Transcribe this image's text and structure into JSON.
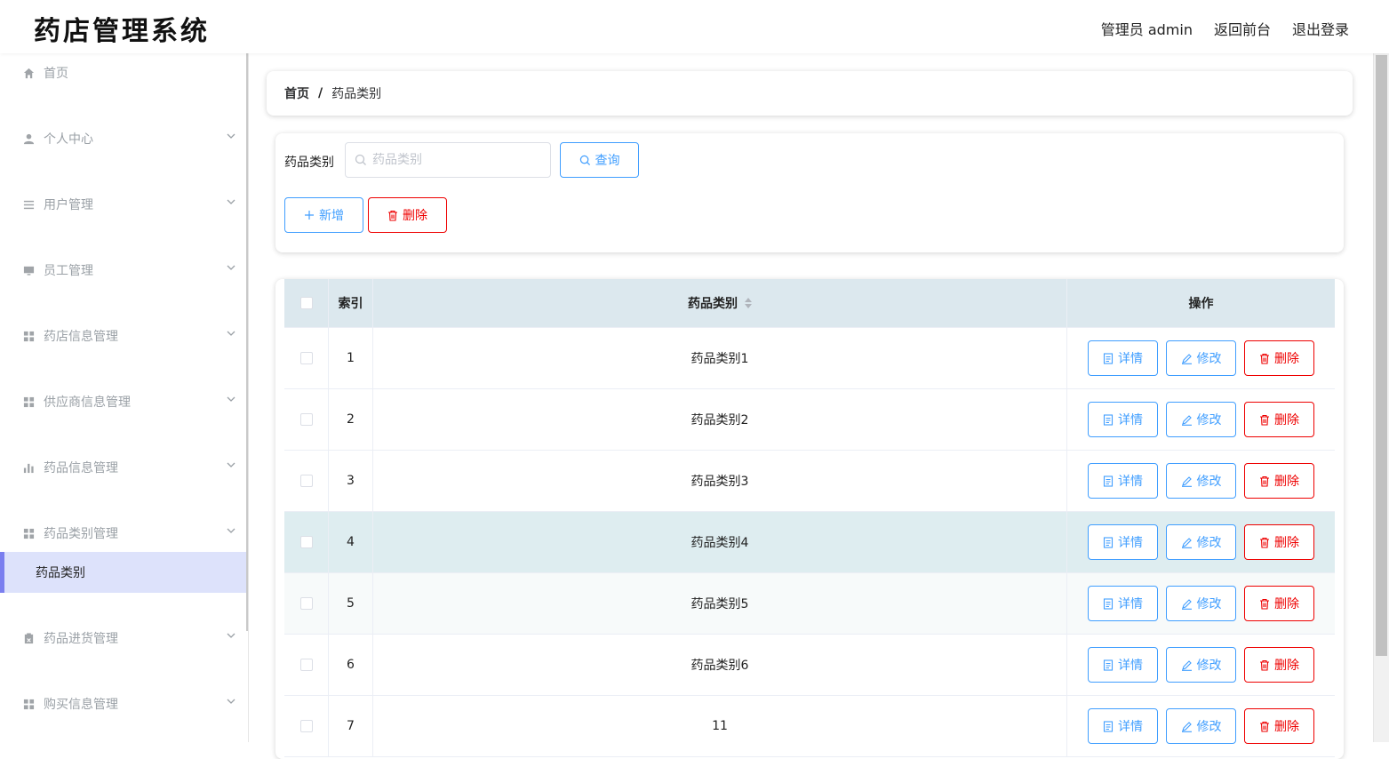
{
  "header": {
    "title": "药店管理系统",
    "admin": "管理员 admin",
    "back_front": "返回前台",
    "logout": "退出登录"
  },
  "sidebar": {
    "items": [
      {
        "label": "首页",
        "icon": "home-icon"
      },
      {
        "label": "个人中心",
        "icon": "user-icon"
      },
      {
        "label": "用户管理",
        "icon": "list-icon"
      },
      {
        "label": "员工管理",
        "icon": "monitor-icon"
      },
      {
        "label": "药店信息管理",
        "icon": "grid-icon"
      },
      {
        "label": "供应商信息管理",
        "icon": "grid-icon"
      },
      {
        "label": "药品信息管理",
        "icon": "bar-chart-icon"
      },
      {
        "label": "药品类别管理",
        "icon": "grid-icon"
      },
      {
        "label": "药品进货管理",
        "icon": "clipboard-icon"
      },
      {
        "label": "购买信息管理",
        "icon": "grid-icon"
      }
    ],
    "active_sub": "药品类别"
  },
  "breadcrumb": {
    "home": "首页",
    "sep": "/",
    "current": "药品类别"
  },
  "search": {
    "label": "药品类别",
    "placeholder": "药品类别",
    "query_label": "查询",
    "add_label": "新增",
    "delete_label": "删除"
  },
  "table": {
    "headers": {
      "index": "索引",
      "category": "药品类别",
      "actions": "操作"
    },
    "rows": [
      {
        "index": "1",
        "category": "药品类别1"
      },
      {
        "index": "2",
        "category": "药品类别2"
      },
      {
        "index": "3",
        "category": "药品类别3"
      },
      {
        "index": "4",
        "category": "药品类别4"
      },
      {
        "index": "5",
        "category": "药品类别5"
      },
      {
        "index": "6",
        "category": "药品类别6"
      },
      {
        "index": "7",
        "category": "11"
      }
    ],
    "row_actions": {
      "detail": "详情",
      "edit": "修改",
      "delete": "删除"
    }
  },
  "colors": {
    "accent": "#409eff",
    "danger": "#ee0000",
    "active_bg": "#dde2fb",
    "active_bar": "#7b7fef"
  }
}
